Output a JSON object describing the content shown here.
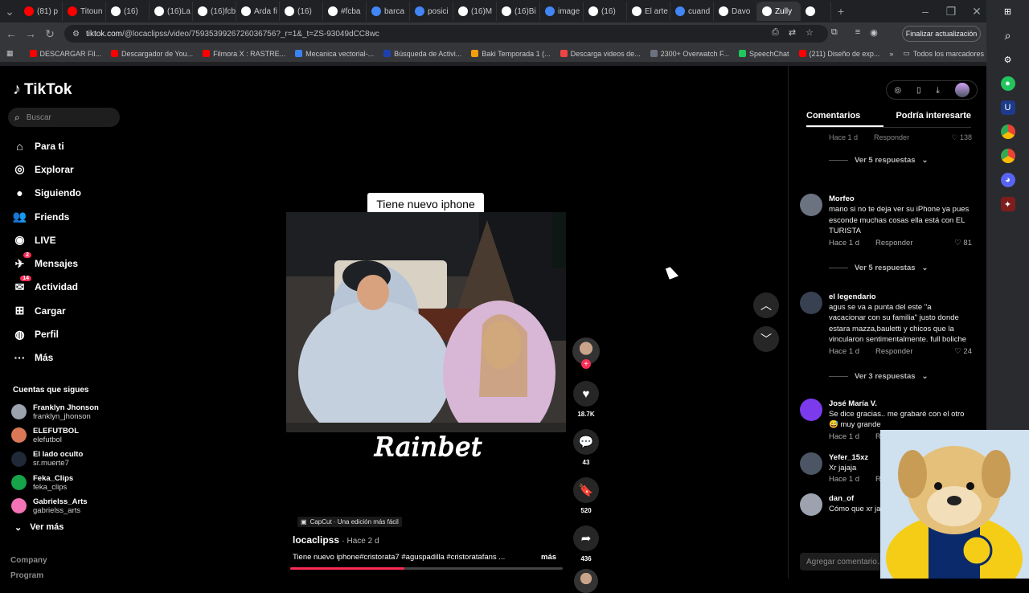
{
  "browser": {
    "tabs": [
      {
        "label": "(81) p",
        "color": "#ff0000"
      },
      {
        "label": "Titoun",
        "color": "#ff0000"
      },
      {
        "label": "(16)",
        "color": "#ffffff"
      },
      {
        "label": "(16)La",
        "color": "#ffffff"
      },
      {
        "label": "(16)fcb",
        "color": "#ffffff"
      },
      {
        "label": "Arda fi",
        "color": "#ffffff"
      },
      {
        "label": "(16)",
        "color": "#ffffff"
      },
      {
        "label": "#fcba",
        "color": "#ffffff"
      },
      {
        "label": "barca",
        "color": "#4285f4"
      },
      {
        "label": "posici",
        "color": "#4285f4"
      },
      {
        "label": "(16)M",
        "color": "#ffffff"
      },
      {
        "label": "(16)Bi",
        "color": "#ffffff"
      },
      {
        "label": "image",
        "color": "#4285f4"
      },
      {
        "label": "(16)",
        "color": "#ffffff"
      },
      {
        "label": "El arte",
        "color": "#ffffff"
      },
      {
        "label": "cuand",
        "color": "#4285f4"
      },
      {
        "label": "Davo",
        "color": "#ffffff"
      },
      {
        "label": "Zully",
        "color": "#ffffff"
      },
      {
        "label": "",
        "color": "#ffffff"
      }
    ],
    "url_host": "tiktok.com",
    "url_path": "/@locaclipss/video/7593539926726036756?_r=1&_t=ZS-93049dCC8wc",
    "update_label": "Finalizar actualización",
    "bookmarks": [
      {
        "label": "DESCARGAR Fil...",
        "color": "#ff0000"
      },
      {
        "label": "Descargador de You...",
        "color": "#ff0000"
      },
      {
        "label": "Filmora X : RASTRE...",
        "color": "#ff0000"
      },
      {
        "label": "Mecanica vectorial-...",
        "color": "#3b82f6"
      },
      {
        "label": "Búsqueda de Activi...",
        "color": "#1e40af"
      },
      {
        "label": "Baki Temporada 1 (...",
        "color": "#f59e0b"
      },
      {
        "label": "Descarga videos de...",
        "color": "#ef4444"
      },
      {
        "label": "2300+ Overwatch F...",
        "color": "#6b7280"
      },
      {
        "label": "SpeechChat",
        "color": "#22c55e"
      },
      {
        "label": "(211) Diseño de exp...",
        "color": "#ff0000"
      }
    ],
    "all_bookmarks_label": "Todos los marcadores"
  },
  "sidebar": {
    "brand": "TikTok",
    "search_placeholder": "Buscar",
    "nav": [
      {
        "label": "Para ti",
        "icon": "home-icon",
        "badge": ""
      },
      {
        "label": "Explorar",
        "icon": "compass-icon",
        "badge": ""
      },
      {
        "label": "Siguiendo",
        "icon": "following-icon",
        "badge": ""
      },
      {
        "label": "Friends",
        "icon": "friends-icon",
        "badge": ""
      },
      {
        "label": "LIVE",
        "icon": "live-icon",
        "badge": ""
      },
      {
        "label": "Mensajes",
        "icon": "messages-icon",
        "badge": "2"
      },
      {
        "label": "Actividad",
        "icon": "activity-icon",
        "badge": "14"
      },
      {
        "label": "Cargar",
        "icon": "upload-icon",
        "badge": ""
      },
      {
        "label": "Perfil",
        "icon": "profile-icon",
        "badge": ""
      },
      {
        "label": "Más",
        "icon": "more-icon",
        "badge": ""
      }
    ],
    "follows_title": "Cuentas que sigues",
    "follows": [
      {
        "name": "Franklyn Jhonson",
        "handle": "franklyn_jhonson",
        "color": "#9ca3af"
      },
      {
        "name": "ELEFUTBOL",
        "handle": "elefutbol",
        "color": "#d97757"
      },
      {
        "name": "El lado oculto",
        "handle": "sr.muerte7",
        "color": "#1f2937"
      },
      {
        "name": "Feka_Clips",
        "handle": "feka_clips",
        "color": "#16a34a"
      },
      {
        "name": "Gabrielss_Arts",
        "handle": "gabrielss_arts",
        "color": "#f472b6"
      }
    ],
    "see_more": "Ver más",
    "footer_company": "Company",
    "footer_program": "Program"
  },
  "video": {
    "caption_overlay": "Tiene nuevo iphone",
    "watermark": "Rainbet",
    "capcut_label": "CapCut · Una edición más fácil",
    "author": "locaclipss",
    "time": "· Hace 2 d",
    "description": "Tiene nuevo iphone#cristorata7 #aguspadilla #cristoratafans ...",
    "more_label": "más",
    "progress": 0.42,
    "likes": "18.7K",
    "comments": "43",
    "saves": "520",
    "shares": "436"
  },
  "comments_panel": {
    "tab_comments": "Comentarios",
    "tab_suggested": "Podría interesarte",
    "top_meta_time": "Hace 1 d",
    "top_meta_reply": "Responder",
    "top_meta_likes": "138",
    "view_replies_1": "Ver 5 respuestas",
    "comments": [
      {
        "user": "Morfeo",
        "text": "mano si no te deja ver su iPhone ya pues esconde muchas cosas ella está con EL TURISTA",
        "time": "Hace 1 d",
        "reply": "Responder",
        "likes": "81",
        "replies": "Ver 5 respuestas",
        "color": "#6b7280"
      },
      {
        "user": "el legendario",
        "text": "agus se va a punta del este \"a vacacionar con su familia\" justo donde estara mazza,bauletti y chicos que la vincularon sentimentalmente. full boliche",
        "time": "Hace 1 d",
        "reply": "Responder",
        "likes": "24",
        "replies": "Ver 3 respuestas",
        "color": "#374151"
      },
      {
        "user": "José María V.",
        "text": "Se dice gracias.. me grabaré con el otro 😅 muy grande",
        "time": "Hace 1 d",
        "reply": "Re",
        "likes": "",
        "replies": "",
        "color": "#7c3aed"
      },
      {
        "user": "Yefer_15xz",
        "text": "Xr jajaja",
        "time": "Hace 1 d",
        "reply": "Re",
        "likes": "",
        "replies": "",
        "color": "#4b5563"
      },
      {
        "user": "dan_of",
        "text": "Cómo que xr ja",
        "time": "",
        "reply": "",
        "likes": "",
        "replies": "",
        "color": "#9ca3af"
      }
    ],
    "add_comment_placeholder": "Agregar comentario..."
  }
}
